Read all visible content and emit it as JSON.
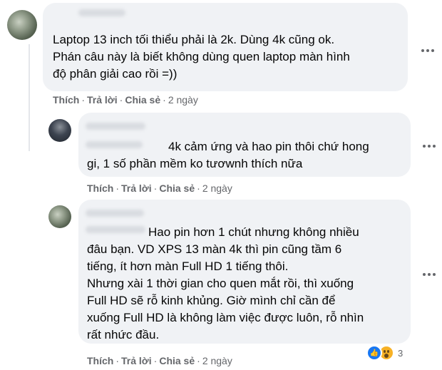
{
  "comment1": {
    "text": "Laptop 13 inch tối thiểu phải là 2k. Dùng 4k cũng ok.\nPhán câu này là biết không dùng quen laptop màn hình\nđộ phân giải cao rồi =))",
    "like": "Thích",
    "reply": "Trả lời",
    "share": "Chia sẻ",
    "time": "2 ngày"
  },
  "reply1": {
    "text_line1": "4k cảm ứng và hao pin thôi chứ hong",
    "text_line2": "gi, 1 số phần mềm ko tươwnh thích nữa",
    "like": "Thích",
    "reply": "Trả lời",
    "share": "Chia sẻ",
    "time": "2 ngày"
  },
  "reply2": {
    "text_line1": "Hao pin hơn 1 chút nhưng không nhiều",
    "text_rest": "đâu bạn. VD XPS 13 màn 4k thì pin cũng tầm 6\ntiếng, ít hơn màn Full HD 1 tiếng thôi.\nNhưng xài 1 thời gian cho quen mắt rồi, thì xuống\nFull HD sẽ rỗ kinh khủng. Giờ mình chỉ cần để\nxuống Full HD là không làm việc được luôn, rỗ nhìn\nrất nhức đầu.",
    "like": "Thích",
    "reply": "Trả lời",
    "share": "Chia sẻ",
    "time": "2 ngày",
    "reactions": {
      "icons": [
        "like-icon",
        "wow-icon"
      ],
      "count": "3"
    }
  },
  "separator": "·",
  "colors": {
    "bubble": "#f0f2f5",
    "meta": "#65676b",
    "like": "#1877f2",
    "wow": "#f7b125"
  }
}
